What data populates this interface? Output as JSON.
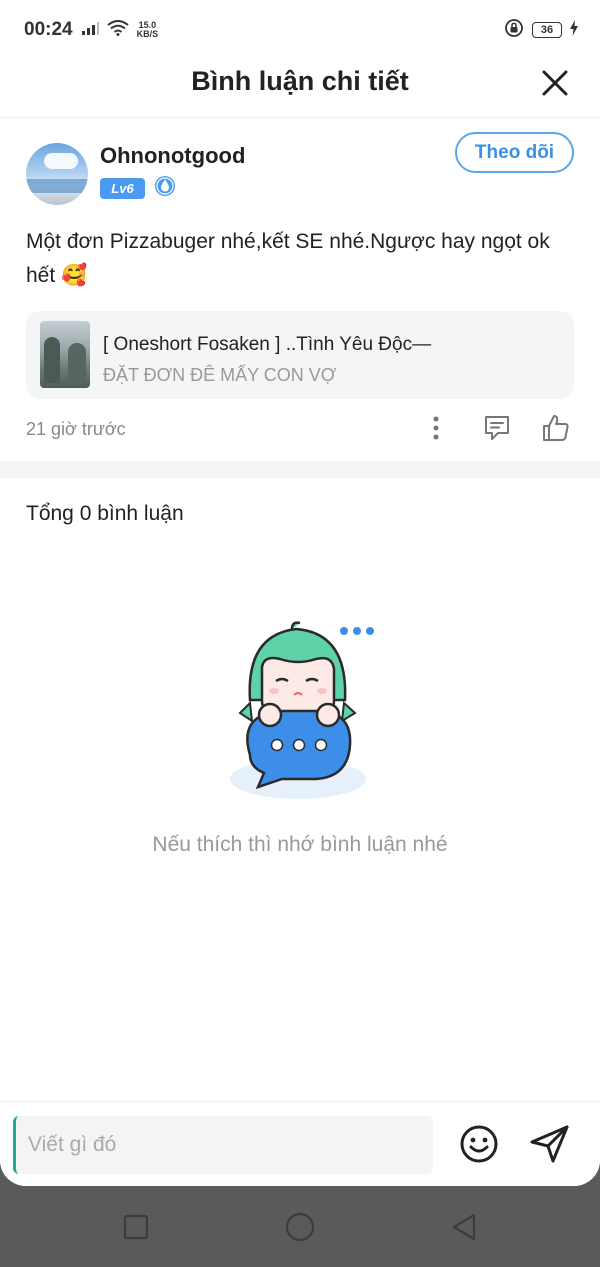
{
  "status_bar": {
    "time": "00:24",
    "net_speed_value": "15.0",
    "net_speed_unit": "KB/S",
    "battery": "36"
  },
  "header": {
    "title": "Bình luận chi tiết",
    "close_icon": "close-icon"
  },
  "post": {
    "author": {
      "username": "Ohnonotgood",
      "level": "Lv6",
      "verified_icon": "water-drop-badge-icon"
    },
    "follow_label": "Theo dõi",
    "text": "Một đơn Pizzabuger nhé,kết SE nhé.Ngược hay ngọt ok hết 🥰",
    "story": {
      "title": "[ Oneshort Fosaken ] ..Tình Yêu Độc—",
      "subtitle": "ĐẶT ĐƠN ĐÊ MẤY CON VỢ"
    },
    "time_ago": "21 giờ trước"
  },
  "comments": {
    "total_label": "Tổng 0 bình luận",
    "empty_text": "Nếu thích thì nhớ bình luận nhé"
  },
  "input": {
    "placeholder": "Viết gì đó"
  },
  "colors": {
    "accent": "#4a9bf0",
    "follow_border": "#5aa6ec",
    "mascot_hair": "#5fd3a8",
    "bubble": "#3d8ee8"
  }
}
